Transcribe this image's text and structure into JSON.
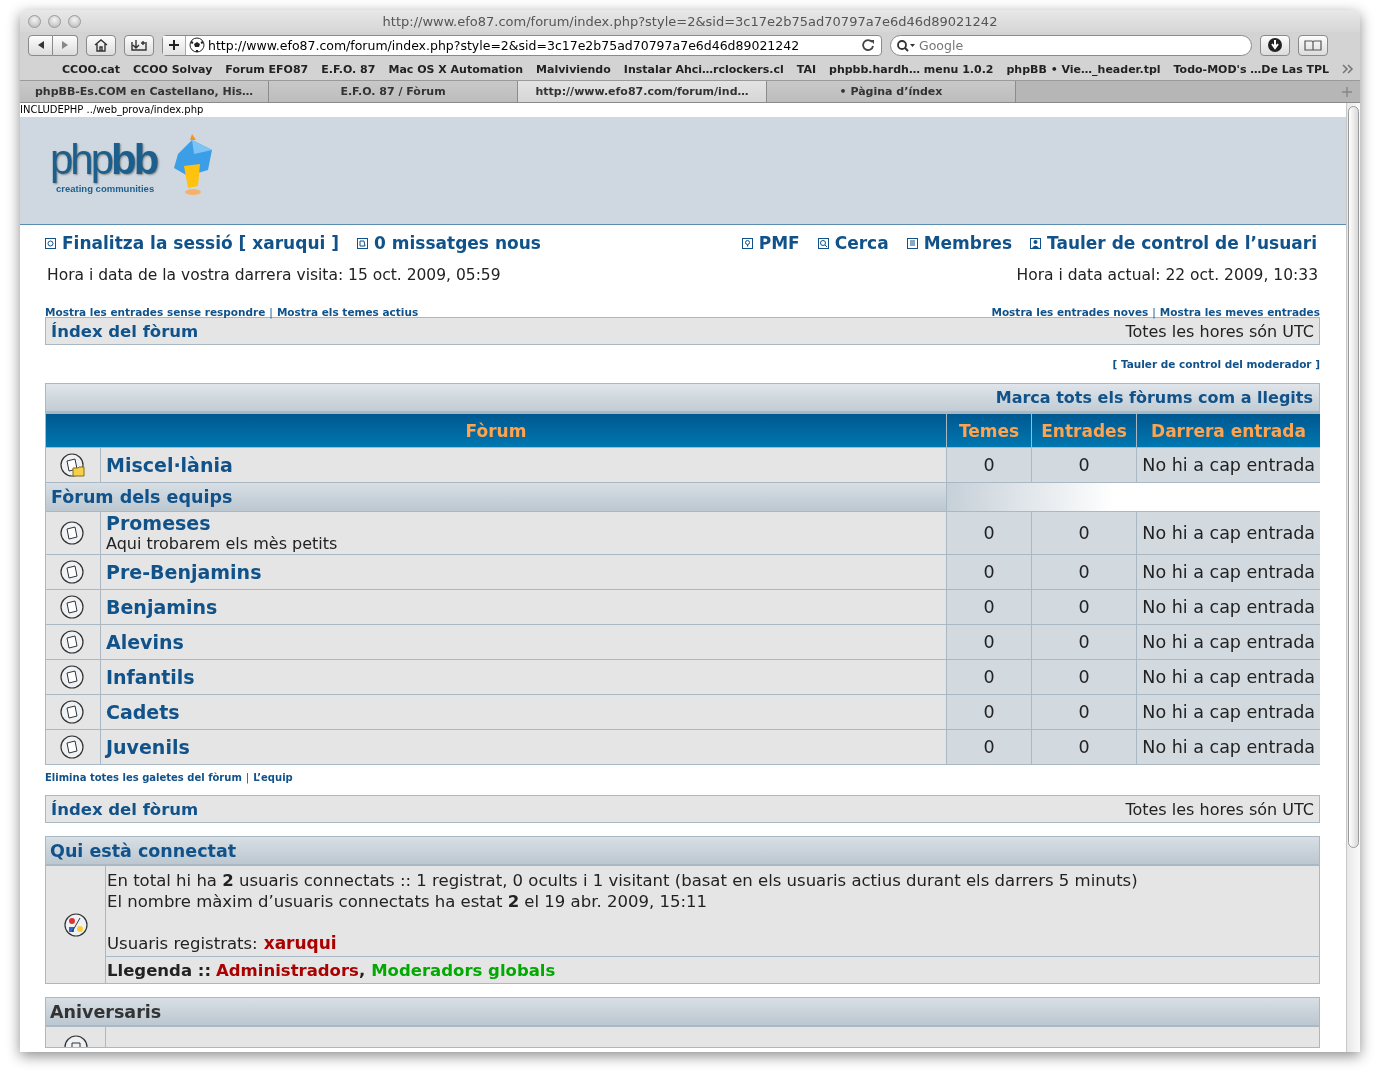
{
  "browser": {
    "title": "http://www.efo87.com/forum/index.php?style=2&sid=3c17e2b75ad70797a7e6d46d89021242",
    "url": "http://www.efo87.com/forum/index.php?style=2&sid=3c17e2b75ad70797a7e6d46d89021242",
    "search": {
      "placeholder": "Google"
    },
    "bookmarks": [
      "CCOO.cat",
      "CCOO Solvay",
      "Forum EFO87",
      "E.F.O. 87",
      "Mac OS X Automation",
      "Malviviendo",
      "Instalar Ahci…rclockers.cl",
      "TAI",
      "phpbb.hardh… menu 1.0.2",
      "phpBB • Vie…_header.tpl",
      "Todo-MOD's …De Las TPL"
    ],
    "tabs": [
      {
        "label": "phpBB-Es.COM en Castellano, His…",
        "selected": false
      },
      {
        "label": "E.F.O. 87 / Fòrum",
        "selected": false
      },
      {
        "label": "http://www.efo87.com/forum/ind…",
        "selected": true
      },
      {
        "label": "• Pàgina d’índex",
        "selected": false
      }
    ]
  },
  "status_text": "INCLUDEPHP ../web_prova/index.php",
  "logo": {
    "wordmark": "php**bb**",
    "tagline": "creating communities"
  },
  "user_links": [
    "Finalitza la sessió [ xaruqui ]",
    "0 missatges nous"
  ],
  "nav_links": [
    "PMF",
    "Cerca",
    "Membres",
    "Tauler de control de l’usuari"
  ],
  "last_visit": "Hora i data de la vostra darrera visita: 15 oct. 2009, 05:59",
  "current_time": "Hora i data actual: 22 oct. 2009, 10:33",
  "quick_links_left": {
    "links": [
      "Mostra les entrades sense respondre",
      "Mostra els temes actius"
    ],
    "separator": "|"
  },
  "quick_links_right": {
    "links": [
      "Mostra les entrades noves",
      "Mostra les meves entrades"
    ],
    "separator": "|"
  },
  "breadcrumb_top": {
    "label": "Índex del fòrum",
    "timezone": "Totes les hores són UTC"
  },
  "moderator_link": "[ Tauler de control del moderador ]",
  "mark_read": "Marca tots els fòrums com a llegits",
  "table": {
    "columns": [
      "Fòrum",
      "Temes",
      "Entrades",
      "Darrera entrada"
    ],
    "rows": [
      {
        "kind": "forum",
        "name": "Miscel·lània",
        "has_subforums": true,
        "topics": "0",
        "posts": "0",
        "last_post": "No hi a cap entrada"
      },
      {
        "kind": "category",
        "name": "Fòrum dels equips"
      },
      {
        "kind": "forum",
        "name": "Promeses",
        "description": "Aqui trobarem els mès petits",
        "has_subforums": false,
        "topics": "0",
        "posts": "0",
        "last_post": "No hi a cap entrada"
      },
      {
        "kind": "forum",
        "name": "Pre-Benjamins",
        "has_subforums": false,
        "topics": "0",
        "posts": "0",
        "last_post": "No hi a cap entrada"
      },
      {
        "kind": "forum",
        "name": "Benjamins",
        "has_subforums": false,
        "topics": "0",
        "posts": "0",
        "last_post": "No hi a cap entrada"
      },
      {
        "kind": "forum",
        "name": "Alevins",
        "has_subforums": false,
        "topics": "0",
        "posts": "0",
        "last_post": "No hi a cap entrada"
      },
      {
        "kind": "forum",
        "name": "Infantils",
        "has_subforums": false,
        "topics": "0",
        "posts": "0",
        "last_post": "No hi a cap entrada"
      },
      {
        "kind": "forum",
        "name": "Cadets",
        "has_subforums": false,
        "topics": "0",
        "posts": "0",
        "last_post": "No hi a cap entrada"
      },
      {
        "kind": "forum",
        "name": "Juvenils",
        "has_subforums": false,
        "topics": "0",
        "posts": "0",
        "last_post": "No hi a cap entrada"
      }
    ]
  },
  "footer_links": {
    "links": [
      "Elimina totes les galetes del fòrum",
      "L’equip"
    ],
    "separator": "|"
  },
  "breadcrumb_bottom": {
    "label": "Índex del fòrum",
    "timezone": "Totes les hores són UTC"
  },
  "who_is_online": {
    "title": "Qui està connectat",
    "lines": [
      "En total hi ha **2** usuaris connectats :: 1 registrat, 0 ocults i 1 visitant (basat en els usuaris actius durant els darrers 5 minuts)",
      "El nombre màxim d’usuaris connectats ha estat **2** el 19 abr. 2009, 15:11"
    ],
    "registered_label": "Usuaris registrats:",
    "registered_users": [
      "xaruqui"
    ],
    "legend_label": "Llegenda ::",
    "group_separator": ",",
    "groups": [
      {
        "name": "Administradors",
        "color": "#aa0000"
      },
      {
        "name": "Moderadors globals",
        "color": "#00aa00"
      }
    ]
  },
  "birthdays": {
    "title": "Aniversaris"
  }
}
